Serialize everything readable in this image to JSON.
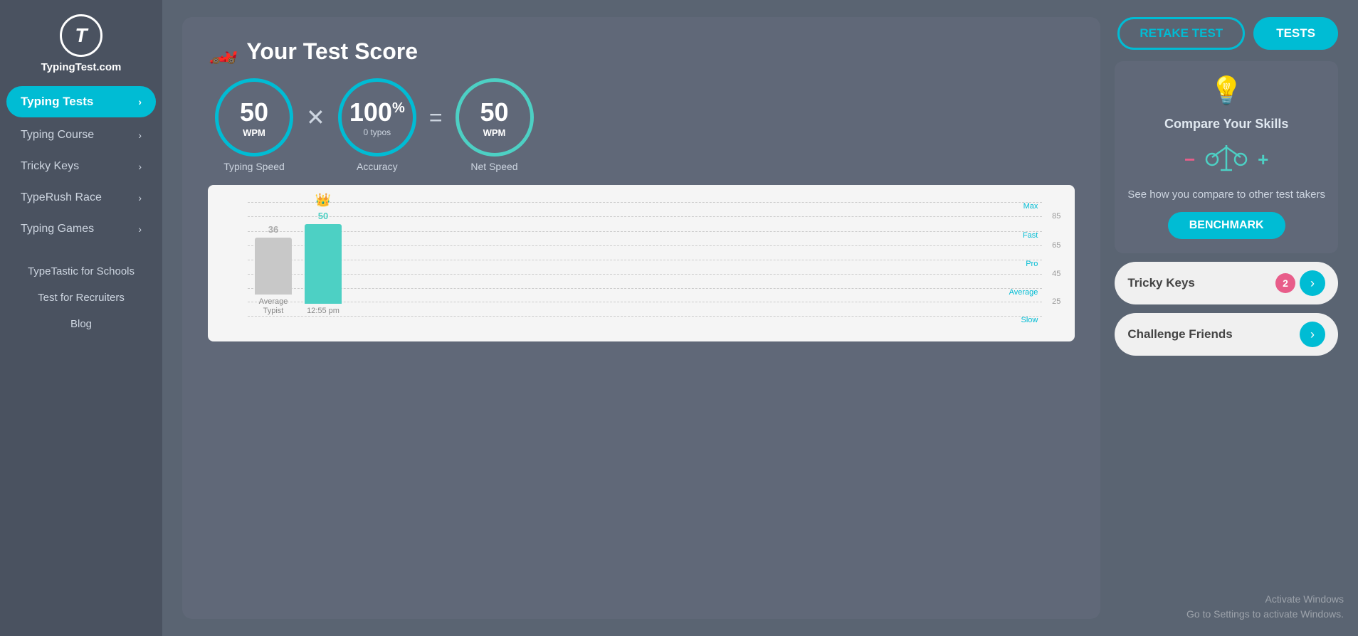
{
  "logo": {
    "t": "T",
    "text": "TypingTest.com"
  },
  "sidebar": {
    "items": [
      {
        "label": "Typing Tests",
        "active": true,
        "hasChevron": true
      },
      {
        "label": "Typing Course",
        "active": false,
        "hasChevron": true
      },
      {
        "label": "Tricky Keys",
        "active": false,
        "hasChevron": true
      },
      {
        "label": "TypeRush Race",
        "active": false,
        "hasChevron": true
      },
      {
        "label": "Typing Games",
        "active": false,
        "hasChevron": true
      }
    ],
    "plain_items": [
      {
        "label": "TypeTastic for Schools"
      },
      {
        "label": "Test for Recruiters"
      },
      {
        "label": "Blog"
      }
    ]
  },
  "score": {
    "title": "Your Test Score",
    "typing_speed": {
      "value": "50",
      "unit": "WPM",
      "label": "Typing Speed"
    },
    "accuracy": {
      "value": "100",
      "unit": "%",
      "sub": "0  typos",
      "label": "Accuracy"
    },
    "net_speed": {
      "value": "50",
      "unit": "WPM",
      "label": "Net Speed"
    },
    "operator_multiply": "✕",
    "operator_equals": "="
  },
  "chart": {
    "y_labels": [
      {
        "value": "Max",
        "y_pct": 95
      },
      {
        "value": "85",
        "y_pct": 85
      },
      {
        "value": "Fast",
        "y_pct": 74
      },
      {
        "value": "65",
        "y_pct": 65
      },
      {
        "value": "Pro",
        "y_pct": 55
      },
      {
        "value": "45",
        "y_pct": 46
      },
      {
        "value": "Average",
        "y_pct": 37
      },
      {
        "value": "25",
        "y_pct": 26
      },
      {
        "value": "Slow",
        "y_pct": 16
      }
    ],
    "bars": [
      {
        "label": "Average\nTypist",
        "value": 36,
        "type": "avg"
      },
      {
        "label": "12:55 pm",
        "value": 50,
        "type": "user"
      }
    ]
  },
  "right_panel": {
    "retake_label": "RETAKE TEST",
    "tests_label": "TESTS",
    "compare": {
      "title": "Compare Your Skills",
      "description": "See how you compare\nto other test takers",
      "benchmark_label": "BENCHMARK"
    },
    "tricky_keys": {
      "label": "Tricky Keys",
      "badge": "2"
    },
    "challenge_friends": {
      "label": "Challenge Friends"
    }
  },
  "activate_windows": {
    "line1": "Activate Windows",
    "line2": "Go to Settings to activate Windows."
  }
}
